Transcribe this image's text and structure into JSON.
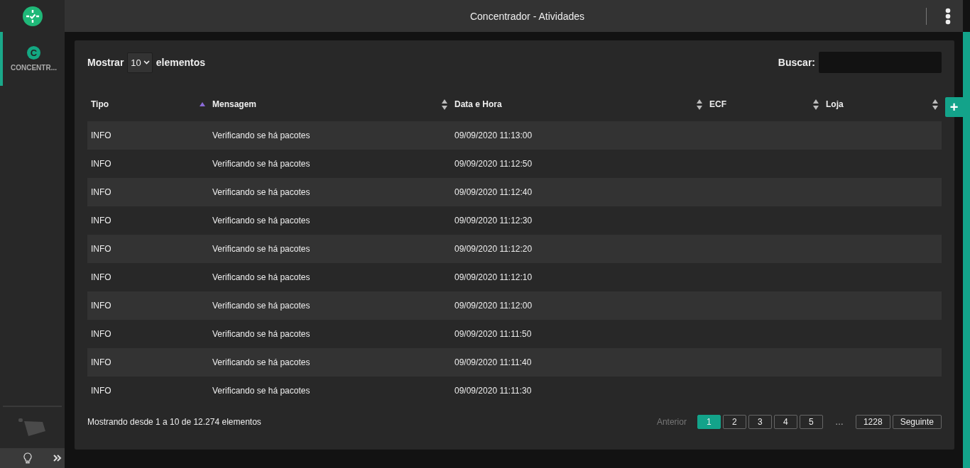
{
  "window": {
    "title": "Concentrador - Atividades"
  },
  "sidebar": {
    "items": [
      {
        "letter": "C",
        "label": "CONCENTR...",
        "selected": true
      }
    ]
  },
  "table_controls": {
    "show_label": "Mostrar",
    "page_size": "10",
    "show_suffix": "elementos",
    "search_label": "Buscar:"
  },
  "table": {
    "columns": [
      {
        "label": "Tipo",
        "sorted": true
      },
      {
        "label": "Mensagem",
        "sorted": false
      },
      {
        "label": "Data e Hora",
        "sorted": false
      },
      {
        "label": "ECF",
        "sorted": false
      },
      {
        "label": "Loja",
        "sorted": false
      }
    ],
    "rows": [
      {
        "tipo": "INFO",
        "mensagem": "Verificando se há pacotes",
        "data_hora": "09/09/2020 11:13:00"
      },
      {
        "tipo": "INFO",
        "mensagem": "Verificando se há pacotes",
        "data_hora": "09/09/2020 11:12:50"
      },
      {
        "tipo": "INFO",
        "mensagem": "Verificando se há pacotes",
        "data_hora": "09/09/2020 11:12:40"
      },
      {
        "tipo": "INFO",
        "mensagem": "Verificando se há pacotes",
        "data_hora": "09/09/2020 11:12:30"
      },
      {
        "tipo": "INFO",
        "mensagem": "Verificando se há pacotes",
        "data_hora": "09/09/2020 11:12:20"
      },
      {
        "tipo": "INFO",
        "mensagem": "Verificando se há pacotes",
        "data_hora": "09/09/2020 11:12:10"
      },
      {
        "tipo": "INFO",
        "mensagem": "Verificando se há pacotes",
        "data_hora": "09/09/2020 11:12:00"
      },
      {
        "tipo": "INFO",
        "mensagem": "Verificando se há pacotes",
        "data_hora": "09/09/2020 11:11:50"
      },
      {
        "tipo": "INFO",
        "mensagem": "Verificando se há pacotes",
        "data_hora": "09/09/2020 11:11:40"
      },
      {
        "tipo": "INFO",
        "mensagem": "Verificando se há pacotes",
        "data_hora": "09/09/2020 11:11:30"
      }
    ]
  },
  "footer": {
    "info": "Mostrando desde 1 a 10 de 12.274 elementos",
    "previous": "Anterior",
    "pages": [
      {
        "label": "1",
        "kind": "page",
        "selected": true
      },
      {
        "label": "2",
        "kind": "page",
        "selected": false
      },
      {
        "label": "3",
        "kind": "page",
        "selected": false
      },
      {
        "label": "4",
        "kind": "page",
        "selected": false
      },
      {
        "label": "5",
        "kind": "page",
        "selected": false
      },
      {
        "label": "…",
        "kind": "gap"
      },
      {
        "label": "1228",
        "kind": "page",
        "selected": false
      }
    ],
    "next": "Seguinte"
  },
  "side_tab": {
    "label": "+"
  }
}
